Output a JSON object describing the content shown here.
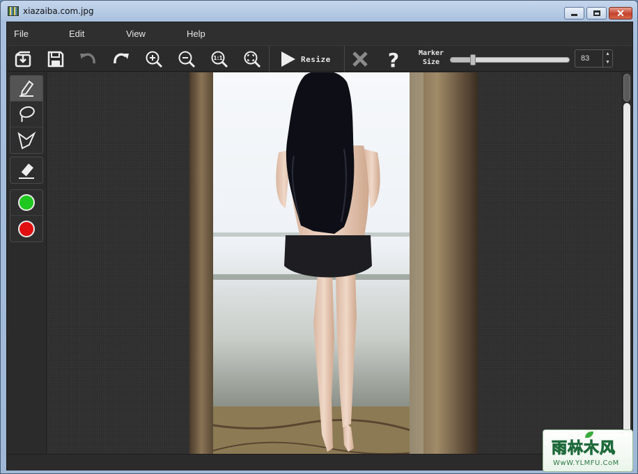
{
  "window": {
    "title": "xiazaiba.com.jpg",
    "controls": {
      "minimize": "minimize",
      "maximize": "maximize",
      "close": "✕"
    }
  },
  "menu": {
    "items": [
      "File",
      "Edit",
      "View",
      "Help"
    ]
  },
  "toolbar": {
    "buttons": [
      {
        "icon": "import-icon",
        "label": "Open"
      },
      {
        "icon": "save-icon",
        "label": "Save"
      },
      {
        "icon": "undo-icon",
        "label": "Undo"
      },
      {
        "icon": "redo-icon",
        "label": "Redo"
      },
      {
        "icon": "zoom-in-icon",
        "label": "Zoom In"
      },
      {
        "icon": "zoom-out-icon",
        "label": "Zoom Out"
      },
      {
        "icon": "actual-size-icon",
        "label": "1:1"
      },
      {
        "icon": "fit-icon",
        "label": "Fit"
      }
    ],
    "resize_label": "Resize",
    "marker_label_line1": "Marker",
    "marker_label_line2": "Size",
    "marker_size_value": "83",
    "marker_size_fraction": 0.19,
    "one_to_one": "1:1"
  },
  "tools": {
    "marker": {
      "icon": "marker-pen-icon",
      "active": true
    },
    "lasso": {
      "icon": "lasso-icon"
    },
    "polygon": {
      "icon": "polygon-lasso-icon"
    },
    "eraser": {
      "icon": "eraser-icon"
    },
    "keep_color": "#1ec81e",
    "remove_color": "#e01010"
  },
  "watermark": {
    "main": "雨林木风",
    "url": "WwW.YLMFU.CoM"
  }
}
